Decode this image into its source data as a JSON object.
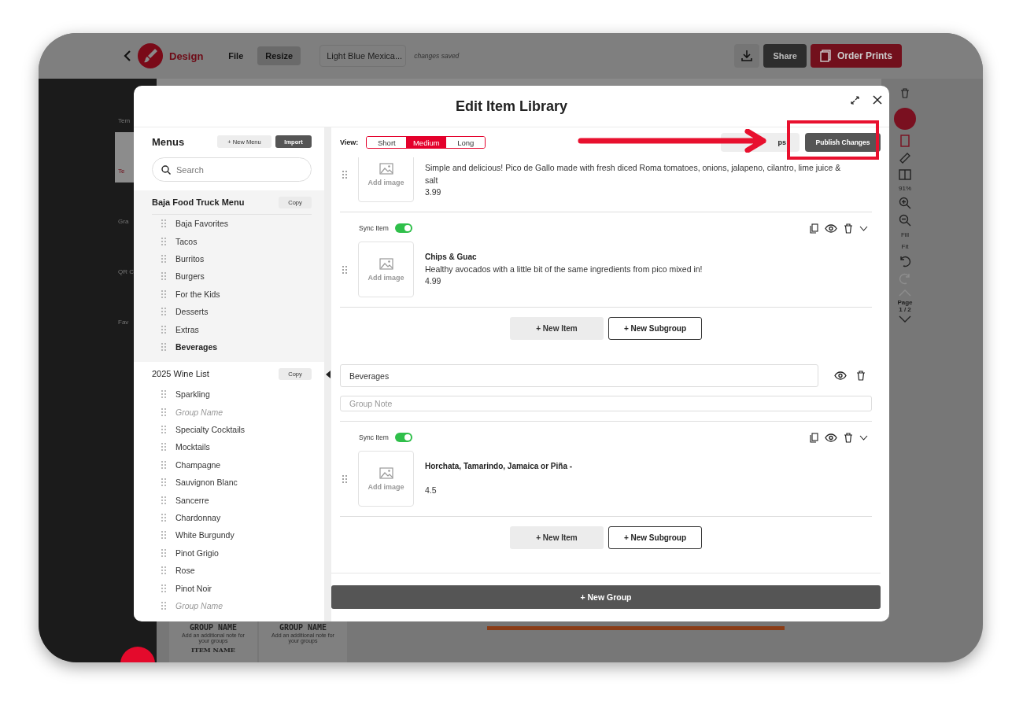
{
  "app": {
    "brand": "Design",
    "menu": [
      {
        "label": "File",
        "selected": false
      },
      {
        "label": "Resize",
        "selected": true
      }
    ],
    "document_name": "Light Blue Mexica...",
    "save_status": "changes saved",
    "share": "Share",
    "order": "Order Prints"
  },
  "tool_sidebar": [
    {
      "label": "Tem",
      "selected": false
    },
    {
      "label": "Te",
      "selected": true
    },
    {
      "label": "Gra",
      "selected": false
    },
    {
      "label": "QR C",
      "selected": false
    },
    {
      "label": "Fav",
      "selected": false
    }
  ],
  "right_toolbar": {
    "zoom": "91%",
    "fill": "Fill",
    "fit": "Fit",
    "page_label": "Page",
    "page": "1 / 2"
  },
  "preview_cards": [
    {
      "title": "GROUP NAME",
      "note": "Add an additional note for your groups",
      "item": "ITEM NAME"
    },
    {
      "title": "GROUP NAME",
      "note": "Add an additional note for your groups"
    }
  ],
  "modal": {
    "title": "Edit Item Library",
    "menus_panel": {
      "heading": "Menus",
      "new_menu": "+ New Menu",
      "import": "Import",
      "search_placeholder": "Search",
      "menus": [
        {
          "name": "Baja Food Truck Menu",
          "copy": "Copy",
          "selected": true,
          "groups": [
            {
              "kind": "group",
              "label": "Baja Favorites",
              "selected": false
            },
            {
              "kind": "group",
              "label": "Tacos",
              "selected": false
            },
            {
              "kind": "group",
              "label": "Burritos",
              "selected": false
            },
            {
              "kind": "group",
              "label": "Burgers",
              "selected": false
            },
            {
              "kind": "group",
              "label": "For the Kids",
              "selected": false
            },
            {
              "kind": "group",
              "label": "Desserts",
              "selected": false
            },
            {
              "kind": "group",
              "label": "Extras",
              "selected": false
            },
            {
              "kind": "group",
              "label": "Beverages",
              "selected": true
            }
          ]
        },
        {
          "name": "2025 Wine List",
          "copy": "Copy",
          "selected": false,
          "groups": [
            {
              "kind": "group",
              "label": "Sparkling",
              "selected": false
            },
            {
              "kind": "placeholder",
              "label": "Group Name",
              "selected": false
            },
            {
              "kind": "group",
              "label": "Specialty Cocktails",
              "selected": false
            },
            {
              "kind": "group",
              "label": "Mocktails",
              "selected": false
            },
            {
              "kind": "group",
              "label": "Champagne",
              "selected": false
            },
            {
              "kind": "group",
              "label": "Sauvignon Blanc",
              "selected": false
            },
            {
              "kind": "group",
              "label": "Sancerre",
              "selected": false
            },
            {
              "kind": "group",
              "label": "Chardonnay",
              "selected": false
            },
            {
              "kind": "group",
              "label": "White Burgundy",
              "selected": false
            },
            {
              "kind": "group",
              "label": "Pinot Grigio",
              "selected": false
            },
            {
              "kind": "group",
              "label": "Rose",
              "selected": false
            },
            {
              "kind": "group",
              "label": "Pinot Noir",
              "selected": false
            },
            {
              "kind": "placeholder",
              "label": "Group Name",
              "selected": false
            }
          ]
        }
      ]
    },
    "view": {
      "label": "View:",
      "options": [
        {
          "label": "Short",
          "selected": false
        },
        {
          "label": "Medium",
          "selected": true
        },
        {
          "label": "Long",
          "selected": false
        }
      ]
    },
    "covered_button": "ps",
    "publish": "Publish Changes",
    "sections": [
      {
        "items": [
          {
            "image_label": "Add image",
            "description": "Simple and delicious! Pico de Gallo made with fresh diced Roma tomatoes, onions, jalapeno, cilantro, lime juice & salt",
            "price": "3.99"
          },
          {
            "sync_label": "Sync Item",
            "synced": true,
            "image_label": "Add image",
            "name": "Chips & Guac",
            "description": "Healthy avocados with a little bit of the same ingredients from pico mixed in!",
            "price": "4.99"
          }
        ],
        "new_item": "+ New Item",
        "new_subgroup": "+ New Subgroup"
      },
      {
        "name": "Beverages",
        "note_placeholder": "Group Note",
        "items": [
          {
            "sync_label": "Sync Item",
            "synced": true,
            "image_label": "Add image",
            "name": "Horchata, Tamarindo, Jamaica or Piña -",
            "price": "4.5"
          }
        ],
        "new_item": "+ New Item",
        "new_subgroup": "+ New Subgroup"
      }
    ],
    "new_group": "+ New Group"
  }
}
